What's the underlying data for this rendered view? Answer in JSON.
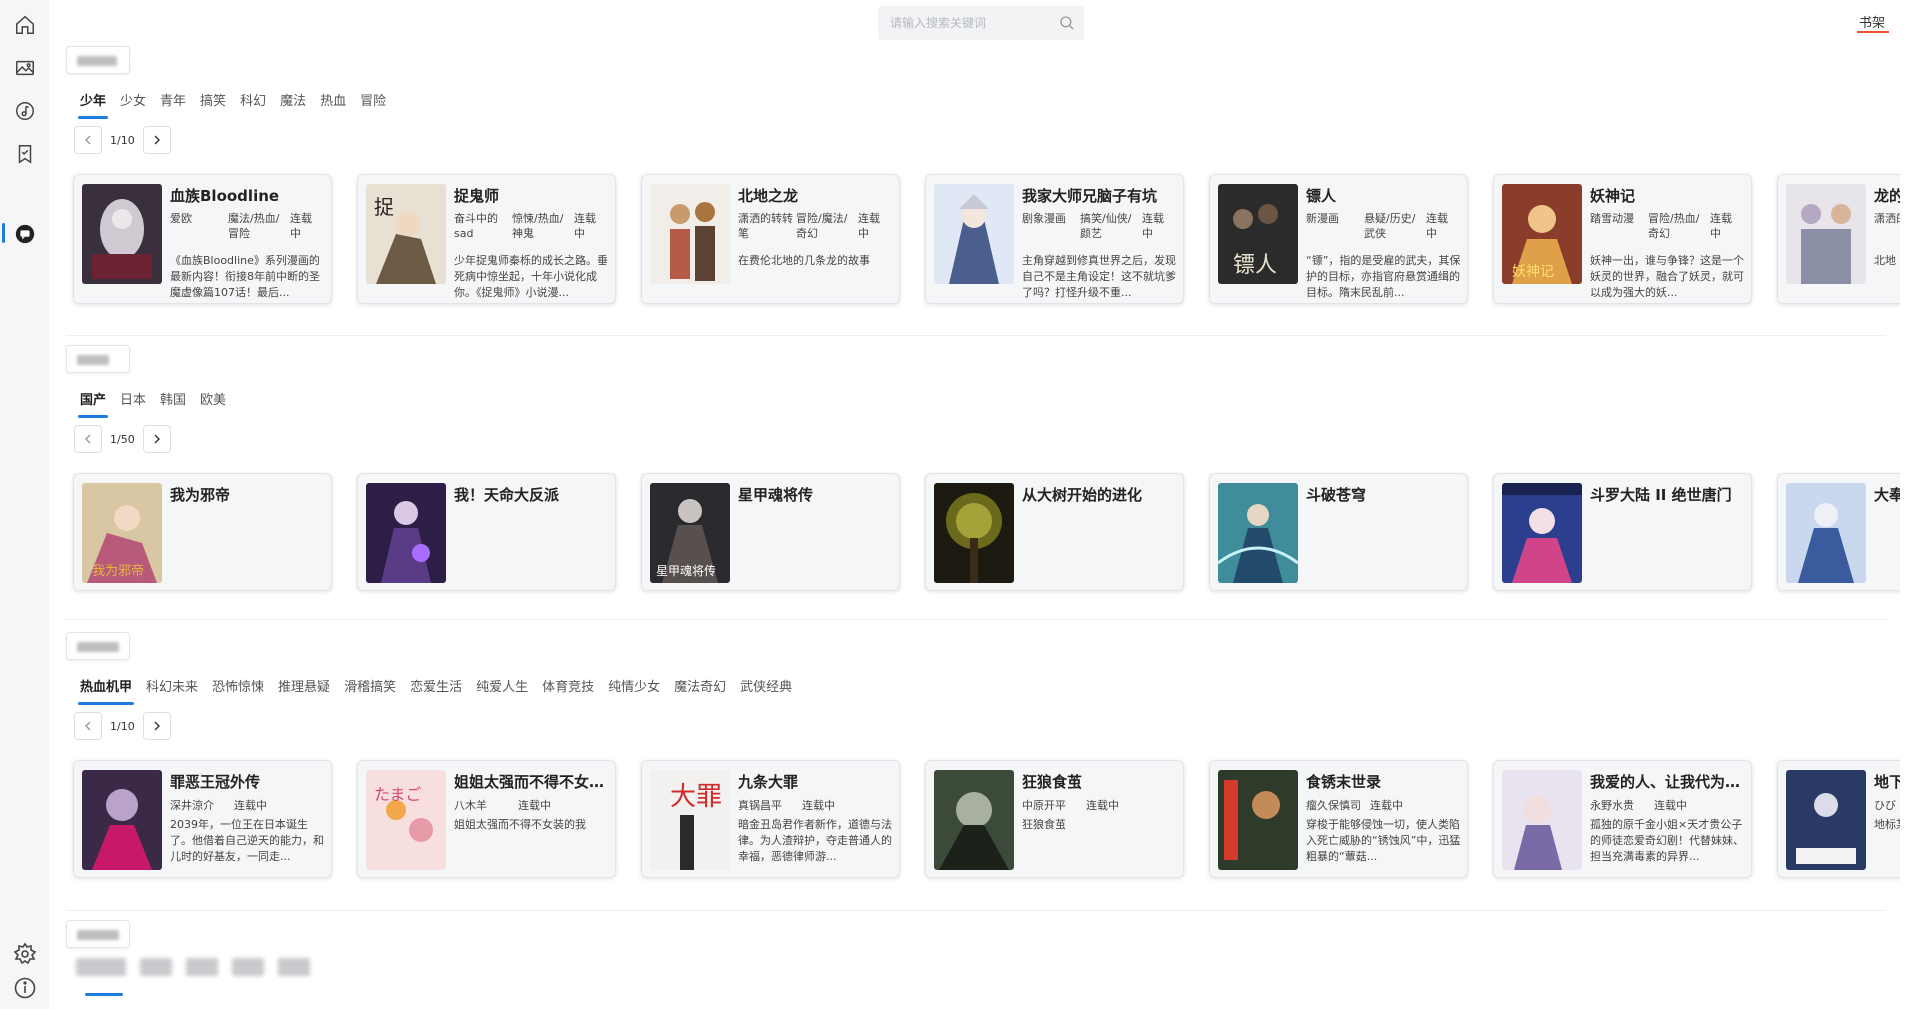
{
  "search": {
    "placeholder": "请输入搜索关键词"
  },
  "header": {
    "bookshelf_label": "书架"
  },
  "sidebar": {
    "items": [
      {
        "name": "home-icon"
      },
      {
        "name": "image-icon"
      },
      {
        "name": "music-icon"
      },
      {
        "name": "bookmark-icon"
      },
      {
        "name": "comic-icon",
        "active": true
      }
    ],
    "bottom": [
      {
        "name": "settings-icon"
      },
      {
        "name": "info-icon"
      }
    ]
  },
  "sections": [
    {
      "tabs": [
        "少年",
        "少女",
        "青年",
        "搞笑",
        "科幻",
        "魔法",
        "热血",
        "冒险"
      ],
      "page": "1/10",
      "cards": [
        {
          "title": "血族Bloodline",
          "author": "爱欧",
          "tags": "魔法/热血/冒险",
          "status": "连载中",
          "desc": "《血族Bloodline》系列漫画的最新内容！衔接8年前中断的圣魔虚像篇107话！最后..."
        },
        {
          "title": "捉鬼师",
          "author": "奋斗中的sad",
          "tags": "惊悚/热血/神鬼",
          "status": "连载中",
          "desc": "少年捉鬼师秦栎的成长之路。垂死病中惊坐起，十年小说化成你。《捉鬼师》小说漫..."
        },
        {
          "title": "北地之龙",
          "author": "潇洒的转转笔",
          "tags": "冒险/魔法/奇幻",
          "status": "连载中",
          "desc": "在费伦北地的几条龙的故事"
        },
        {
          "title": "我家大师兄脑子有坑",
          "author": "剧象漫画",
          "tags": "搞笑/仙侠/颜艺",
          "status": "连载中",
          "desc": "主角穿越到修真世界之后，发现自己不是主角设定！这不就坑爹了吗？打怪升级不重..."
        },
        {
          "title": "镖人",
          "author": "新漫画",
          "tags": "悬疑/历史/武侠",
          "status": "连载中",
          "desc": "“镖”，指的是受雇的武夫，其保护的目标，亦指官府悬赏通缉的目标。隋末民乱前..."
        },
        {
          "title": "妖神记",
          "author": "踏雪动漫",
          "tags": "冒险/热血/奇幻",
          "status": "连载中",
          "desc": "妖神一出，谁与争锋？这是一个妖灵的世界，融合了妖灵，就可以成为强大的妖..."
        },
        {
          "title": "龙的",
          "author": "潇洒的转笔",
          "tags": "",
          "status": "",
          "desc": "北地"
        }
      ]
    },
    {
      "tabs": [
        "国产",
        "日本",
        "韩国",
        "欧美"
      ],
      "page": "1/50",
      "cards": [
        {
          "title": "我为邪帝"
        },
        {
          "title": "我！天命大反派"
        },
        {
          "title": "星甲魂将传"
        },
        {
          "title": "从大树开始的进化"
        },
        {
          "title": "斗破苍穹"
        },
        {
          "title": "斗罗大陆 II 绝世唐门"
        },
        {
          "title": "大奉"
        }
      ]
    },
    {
      "tabs": [
        "热血机甲",
        "科幻未来",
        "恐怖惊悚",
        "推理悬疑",
        "滑稽搞笑",
        "恋爱生活",
        "纯爱人生",
        "体育竞技",
        "纯情少女",
        "魔法奇幻",
        "武侠经典"
      ],
      "page": "1/10",
      "cards": [
        {
          "title": "罪恶王冠外传",
          "author": "深井涼介",
          "status": "连载中",
          "desc": "2039年，一位王在日本诞生了。他借着自己逆天的能力，和儿时的好基友，一同走..."
        },
        {
          "title": "姐姐太强而不得不女装的我",
          "author": "八木羊",
          "status": "连载中",
          "desc": "姐姐太强而不得不女装的我"
        },
        {
          "title": "九条大罪",
          "author": "真锅昌平",
          "status": "连载中",
          "desc": "暗金丑岛君作者新作，道德与法律。为人渣辩护，夺走普通人的幸福，恶德律师游..."
        },
        {
          "title": "狂狼食茧",
          "author": "中原开平",
          "status": "连载中",
          "desc": "狂狼食茧"
        },
        {
          "title": "食锈末世录",
          "author": "瘤久保慎司",
          "status": "连载中",
          "desc": "穿梭于能够侵蚀一切，使人类陷入死亡威胁的“锈蚀风”中，迅猛粗暴的“蕈菇..."
        },
        {
          "title": "我爱的人、让我代为继承",
          "author": "永野水贵",
          "status": "连载中",
          "desc": "孤独的原千金小姐×天才贵公子的师徒恋爱奇幻剧！代替妹妹、担当充满毒素的异界..."
        },
        {
          "title": "地下",
          "author": "ひび",
          "status": "",
          "desc": "地标某兄现在"
        }
      ]
    }
  ],
  "colors": {
    "accent": "#1e7be0",
    "bookshelf_underline": "#e8572a",
    "card_bg": "#f5f6f8"
  }
}
